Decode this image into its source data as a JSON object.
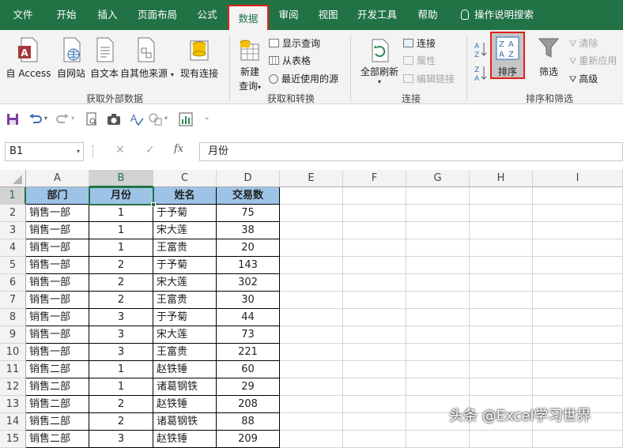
{
  "tabs": [
    {
      "label": "文件"
    },
    {
      "label": "开始"
    },
    {
      "label": "插入"
    },
    {
      "label": "页面布局"
    },
    {
      "label": "公式"
    },
    {
      "label": "数据",
      "active": true
    },
    {
      "label": "审阅"
    },
    {
      "label": "视图"
    },
    {
      "label": "开发工具"
    },
    {
      "label": "帮助"
    }
  ],
  "tell_me": "操作说明搜索",
  "ribbon": {
    "external": {
      "group_label": "获取外部数据",
      "access": "自 Access",
      "web": "自网站",
      "text": "自文本",
      "other": "自其他来源",
      "existing": "现有连接"
    },
    "transform": {
      "group_label": "获取和转换",
      "new_query_1": "新建",
      "new_query_2": "查询",
      "show_queries": "显示查询",
      "from_table": "从表格",
      "recent_sources": "最近使用的源"
    },
    "connections": {
      "group_label": "连接",
      "refresh_all": "全部刷新",
      "connections": "连接",
      "properties": "属性",
      "edit_links": "编辑链接"
    },
    "sort_filter": {
      "group_label": "排序和筛选",
      "sort": "排序",
      "filter": "筛选",
      "clear": "清除",
      "reapply": "重新应用",
      "advanced": "高级"
    }
  },
  "formula_bar": {
    "name_box": "B1",
    "fx": "fx",
    "content": "月份"
  },
  "columns": [
    "A",
    "B",
    "C",
    "D",
    "E",
    "F",
    "G",
    "H",
    "I"
  ],
  "selected_cell": "B1",
  "table": {
    "headers": [
      "部门",
      "月份",
      "姓名",
      "交易数"
    ],
    "rows": [
      [
        "销售一部",
        "1",
        "于予菊",
        "75"
      ],
      [
        "销售一部",
        "1",
        "宋大莲",
        "38"
      ],
      [
        "销售一部",
        "1",
        "王富贵",
        "20"
      ],
      [
        "销售一部",
        "2",
        "于予菊",
        "143"
      ],
      [
        "销售一部",
        "2",
        "宋大莲",
        "302"
      ],
      [
        "销售一部",
        "2",
        "王富贵",
        "30"
      ],
      [
        "销售一部",
        "3",
        "于予菊",
        "44"
      ],
      [
        "销售一部",
        "3",
        "宋大莲",
        "73"
      ],
      [
        "销售一部",
        "3",
        "王富贵",
        "221"
      ],
      [
        "销售二部",
        "1",
        "赵铁锤",
        "60"
      ],
      [
        "销售二部",
        "1",
        "诸葛钢铁",
        "29"
      ],
      [
        "销售二部",
        "2",
        "赵铁锤",
        "208"
      ],
      [
        "销售二部",
        "2",
        "诸葛钢铁",
        "88"
      ],
      [
        "销售二部",
        "3",
        "赵铁锤",
        "209"
      ]
    ]
  },
  "row_numbers": [
    "1",
    "2",
    "3",
    "4",
    "5",
    "6",
    "7",
    "8",
    "9",
    "10",
    "11",
    "12",
    "13",
    "14",
    "15"
  ],
  "watermark": "头条 @Excel学习世界",
  "colors": {
    "excel_green": "#217346",
    "header_fill": "#9dc3e6",
    "highlight_border": "#e0201c"
  }
}
